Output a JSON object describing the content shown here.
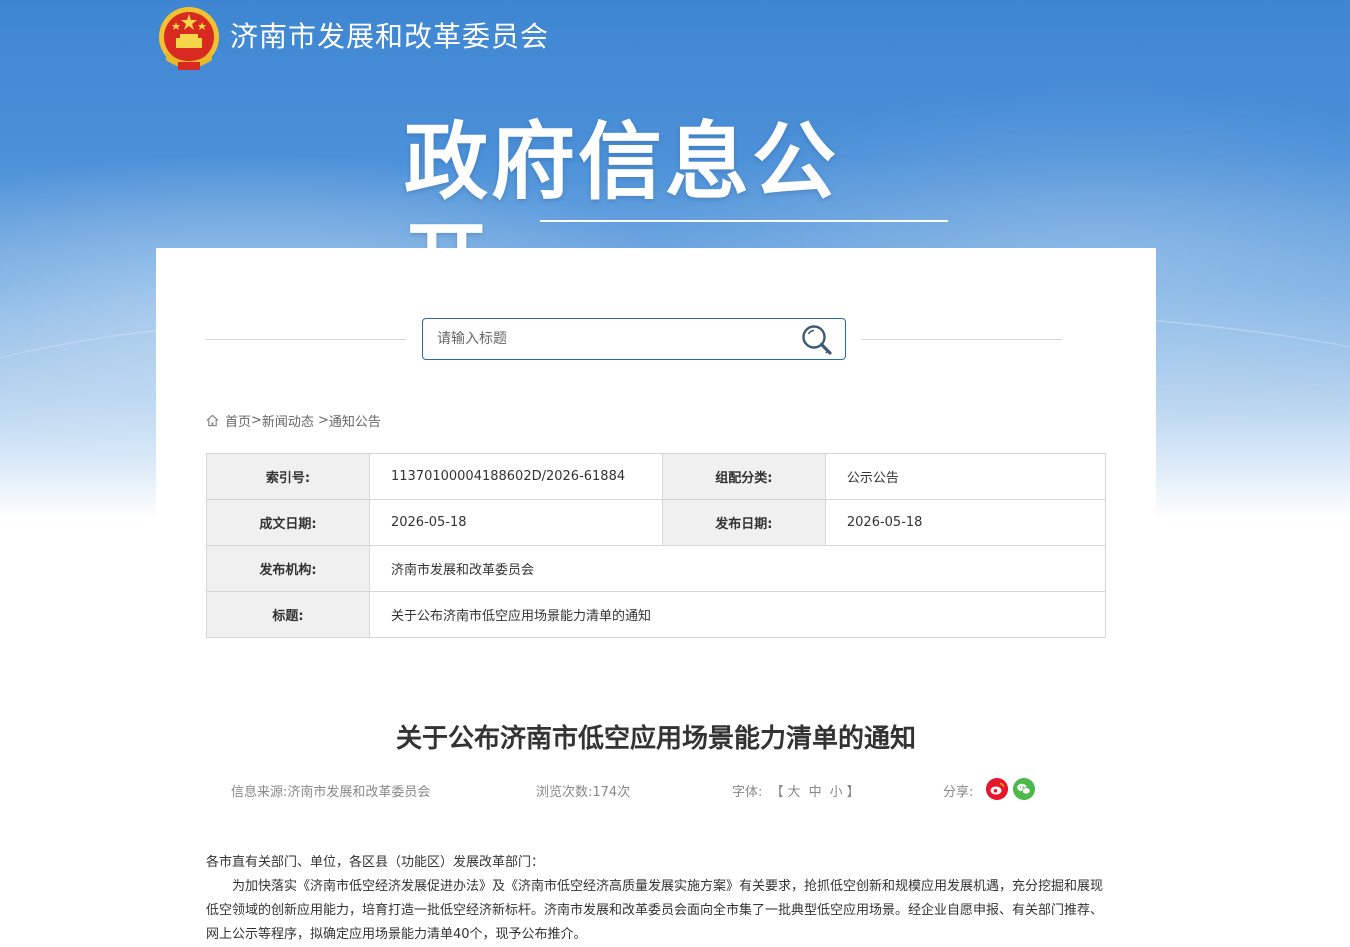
{
  "header": {
    "site_name": "济南市发展和改革委员会",
    "hero_title": "政府信息公开"
  },
  "search": {
    "placeholder": "请输入标题"
  },
  "breadcrumb": {
    "items": [
      "首页",
      "新闻动态",
      "通知公告"
    ],
    "separator": ">"
  },
  "meta": {
    "index_label": "索引号:",
    "index_value": "11370100004188602D/2026-61884",
    "category_label": "组配分类:",
    "category_value": "公示公告",
    "written_label": "成文日期:",
    "written_value": "2026-05-18",
    "published_label": "发布日期:",
    "published_value": "2026-05-18",
    "org_label": "发布机构:",
    "org_value": "济南市发展和改革委员会",
    "title_label": "标题:",
    "title_value": "关于公布济南市低空应用场景能力清单的通知"
  },
  "article": {
    "title": "关于公布济南市低空应用场景能力清单的通知",
    "source_label": "信息来源:",
    "source_value": "济南市发展和改革委员会",
    "views_label": "浏览次数:",
    "views_value": "174次",
    "font_label": "字体:",
    "font_open": "【",
    "font_large": "大",
    "font_medium": "中",
    "font_small": "小",
    "font_close": "】",
    "share_label": "分享:",
    "greeting": "各市直有关部门、单位，各区县（功能区）发展改革部门：",
    "paragraph1": "为加快落实《济南市低空经济发展促进办法》及《济南市低空经济高质量发展实施方案》有关要求，抢抓低空创新和规模应用发展机遇，充分挖掘和展现低空领域的创新应用能力，培育打造一批低空经济新标杆。济南市发展和改革委员会面向全市集了一批典型低空应用场景。经企业自愿申报、有关部门推荐、网上公示等程序，拟确定应用场景能力清单40个，现予公布推介。"
  },
  "colors": {
    "hero_top": "#3f86d2",
    "search_border": "#2b6aa8",
    "label_bg": "#f0f0f0",
    "weibo": "#e6162d",
    "wechat": "#4cb94a"
  }
}
